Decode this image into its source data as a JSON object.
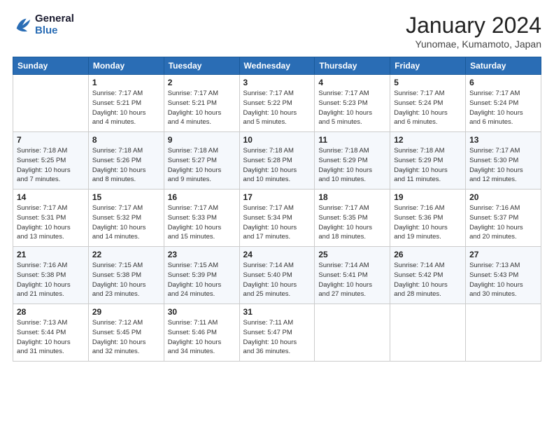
{
  "logo": {
    "line1": "General",
    "line2": "Blue"
  },
  "title": "January 2024",
  "subtitle": "Yunomae, Kumamoto, Japan",
  "header_days": [
    "Sunday",
    "Monday",
    "Tuesday",
    "Wednesday",
    "Thursday",
    "Friday",
    "Saturday"
  ],
  "weeks": [
    [
      {
        "day": "",
        "info": ""
      },
      {
        "day": "1",
        "info": "Sunrise: 7:17 AM\nSunset: 5:21 PM\nDaylight: 10 hours\nand 4 minutes."
      },
      {
        "day": "2",
        "info": "Sunrise: 7:17 AM\nSunset: 5:21 PM\nDaylight: 10 hours\nand 4 minutes."
      },
      {
        "day": "3",
        "info": "Sunrise: 7:17 AM\nSunset: 5:22 PM\nDaylight: 10 hours\nand 5 minutes."
      },
      {
        "day": "4",
        "info": "Sunrise: 7:17 AM\nSunset: 5:23 PM\nDaylight: 10 hours\nand 5 minutes."
      },
      {
        "day": "5",
        "info": "Sunrise: 7:17 AM\nSunset: 5:24 PM\nDaylight: 10 hours\nand 6 minutes."
      },
      {
        "day": "6",
        "info": "Sunrise: 7:17 AM\nSunset: 5:24 PM\nDaylight: 10 hours\nand 6 minutes."
      }
    ],
    [
      {
        "day": "7",
        "info": "Sunrise: 7:18 AM\nSunset: 5:25 PM\nDaylight: 10 hours\nand 7 minutes."
      },
      {
        "day": "8",
        "info": "Sunrise: 7:18 AM\nSunset: 5:26 PM\nDaylight: 10 hours\nand 8 minutes."
      },
      {
        "day": "9",
        "info": "Sunrise: 7:18 AM\nSunset: 5:27 PM\nDaylight: 10 hours\nand 9 minutes."
      },
      {
        "day": "10",
        "info": "Sunrise: 7:18 AM\nSunset: 5:28 PM\nDaylight: 10 hours\nand 10 minutes."
      },
      {
        "day": "11",
        "info": "Sunrise: 7:18 AM\nSunset: 5:29 PM\nDaylight: 10 hours\nand 10 minutes."
      },
      {
        "day": "12",
        "info": "Sunrise: 7:18 AM\nSunset: 5:29 PM\nDaylight: 10 hours\nand 11 minutes."
      },
      {
        "day": "13",
        "info": "Sunrise: 7:17 AM\nSunset: 5:30 PM\nDaylight: 10 hours\nand 12 minutes."
      }
    ],
    [
      {
        "day": "14",
        "info": "Sunrise: 7:17 AM\nSunset: 5:31 PM\nDaylight: 10 hours\nand 13 minutes."
      },
      {
        "day": "15",
        "info": "Sunrise: 7:17 AM\nSunset: 5:32 PM\nDaylight: 10 hours\nand 14 minutes."
      },
      {
        "day": "16",
        "info": "Sunrise: 7:17 AM\nSunset: 5:33 PM\nDaylight: 10 hours\nand 15 minutes."
      },
      {
        "day": "17",
        "info": "Sunrise: 7:17 AM\nSunset: 5:34 PM\nDaylight: 10 hours\nand 17 minutes."
      },
      {
        "day": "18",
        "info": "Sunrise: 7:17 AM\nSunset: 5:35 PM\nDaylight: 10 hours\nand 18 minutes."
      },
      {
        "day": "19",
        "info": "Sunrise: 7:16 AM\nSunset: 5:36 PM\nDaylight: 10 hours\nand 19 minutes."
      },
      {
        "day": "20",
        "info": "Sunrise: 7:16 AM\nSunset: 5:37 PM\nDaylight: 10 hours\nand 20 minutes."
      }
    ],
    [
      {
        "day": "21",
        "info": "Sunrise: 7:16 AM\nSunset: 5:38 PM\nDaylight: 10 hours\nand 21 minutes."
      },
      {
        "day": "22",
        "info": "Sunrise: 7:15 AM\nSunset: 5:38 PM\nDaylight: 10 hours\nand 23 minutes."
      },
      {
        "day": "23",
        "info": "Sunrise: 7:15 AM\nSunset: 5:39 PM\nDaylight: 10 hours\nand 24 minutes."
      },
      {
        "day": "24",
        "info": "Sunrise: 7:14 AM\nSunset: 5:40 PM\nDaylight: 10 hours\nand 25 minutes."
      },
      {
        "day": "25",
        "info": "Sunrise: 7:14 AM\nSunset: 5:41 PM\nDaylight: 10 hours\nand 27 minutes."
      },
      {
        "day": "26",
        "info": "Sunrise: 7:14 AM\nSunset: 5:42 PM\nDaylight: 10 hours\nand 28 minutes."
      },
      {
        "day": "27",
        "info": "Sunrise: 7:13 AM\nSunset: 5:43 PM\nDaylight: 10 hours\nand 30 minutes."
      }
    ],
    [
      {
        "day": "28",
        "info": "Sunrise: 7:13 AM\nSunset: 5:44 PM\nDaylight: 10 hours\nand 31 minutes."
      },
      {
        "day": "29",
        "info": "Sunrise: 7:12 AM\nSunset: 5:45 PM\nDaylight: 10 hours\nand 32 minutes."
      },
      {
        "day": "30",
        "info": "Sunrise: 7:11 AM\nSunset: 5:46 PM\nDaylight: 10 hours\nand 34 minutes."
      },
      {
        "day": "31",
        "info": "Sunrise: 7:11 AM\nSunset: 5:47 PM\nDaylight: 10 hours\nand 36 minutes."
      },
      {
        "day": "",
        "info": ""
      },
      {
        "day": "",
        "info": ""
      },
      {
        "day": "",
        "info": ""
      }
    ]
  ]
}
